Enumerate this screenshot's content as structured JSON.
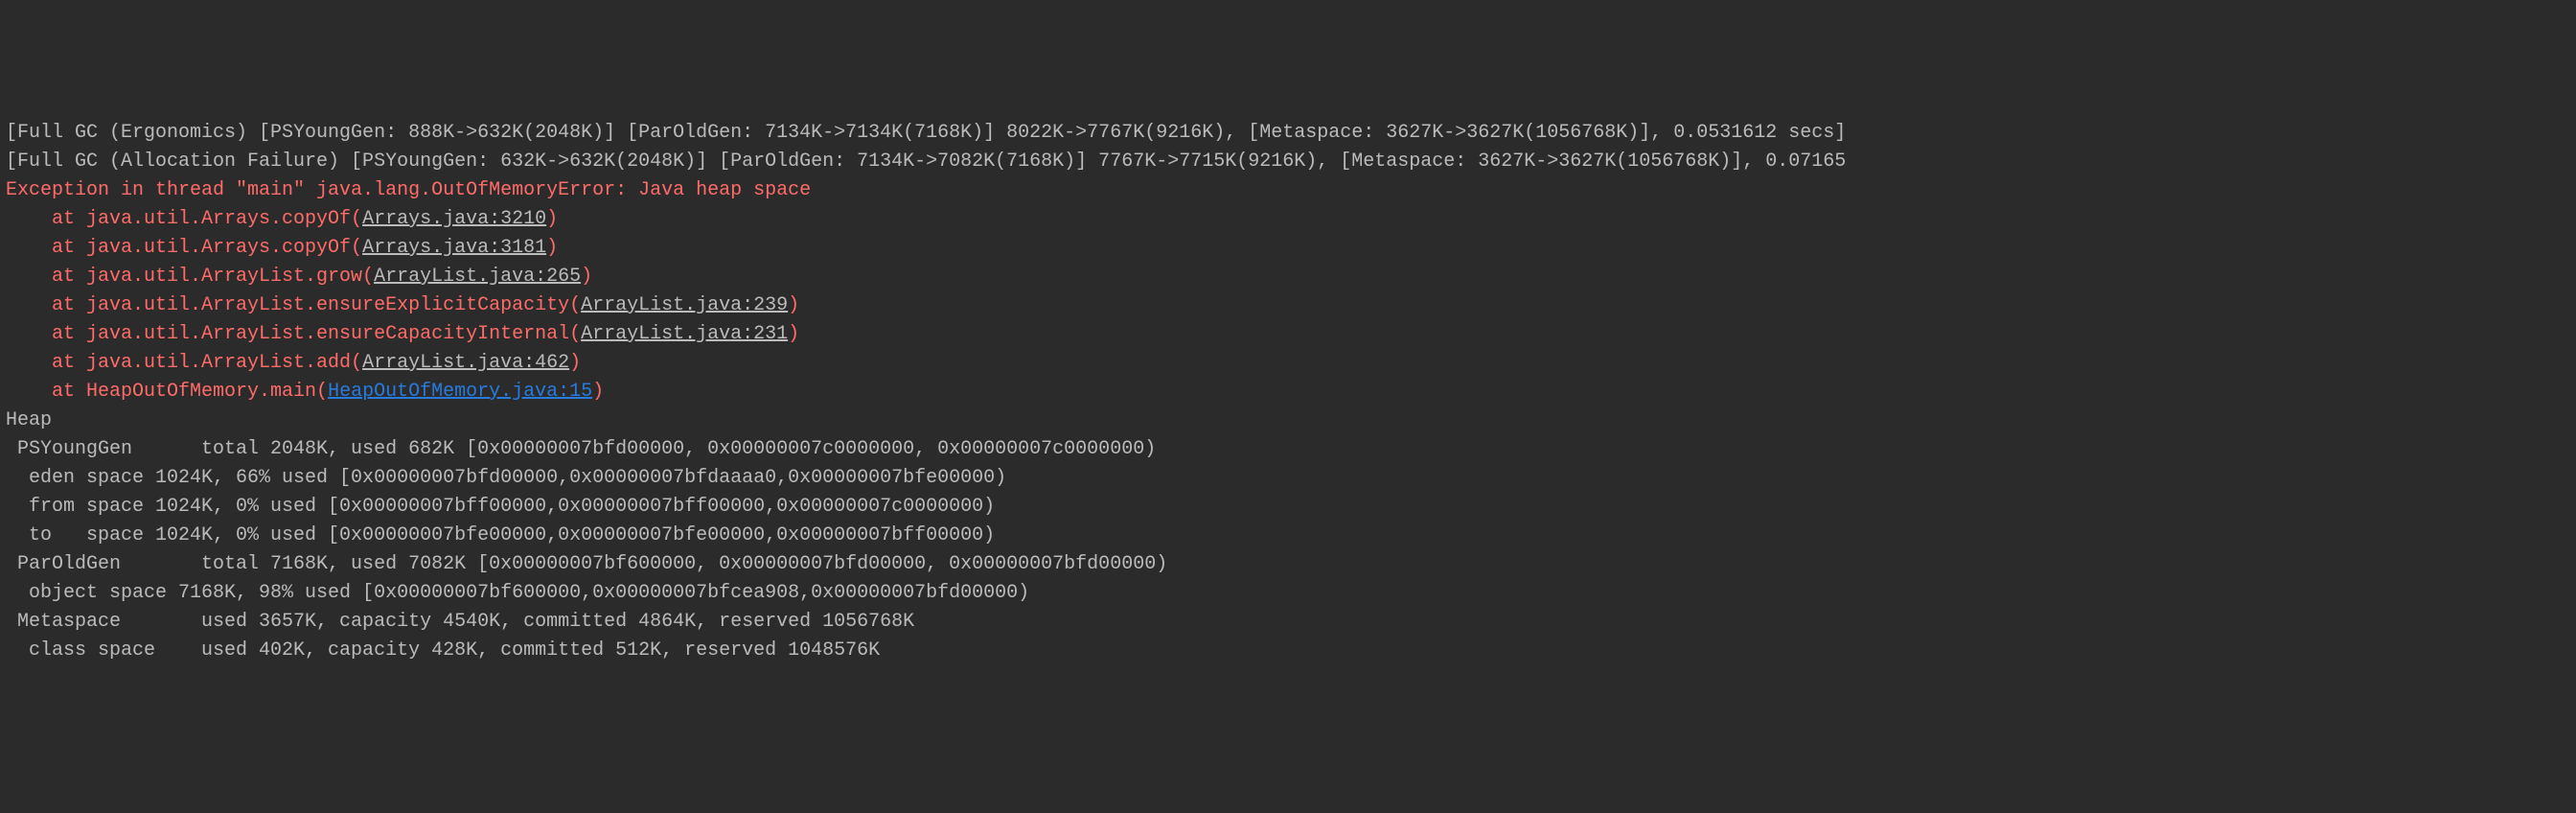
{
  "gc_lines": [
    "[Full GC (Ergonomics) [PSYoungGen: 888K->632K(2048K)] [ParOldGen: 7134K->7134K(7168K)] 8022K->7767K(9216K), [Metaspace: 3627K->3627K(1056768K)], 0.0531612 secs]",
    "[Full GC (Allocation Failure) [PSYoungGen: 632K->632K(2048K)] [ParOldGen: 7134K->7082K(7168K)] 7767K->7715K(9216K), [Metaspace: 3627K->3627K(1056768K)], 0.07165"
  ],
  "exception_header": "Exception in thread \"main\" java.lang.OutOfMemoryError: Java heap space",
  "stack": [
    {
      "prefix": "    at java.util.Arrays.copyOf(",
      "link": "Arrays.java:3210",
      "suffix": ")",
      "blue": false
    },
    {
      "prefix": "    at java.util.Arrays.copyOf(",
      "link": "Arrays.java:3181",
      "suffix": ")",
      "blue": false
    },
    {
      "prefix": "    at java.util.ArrayList.grow(",
      "link": "ArrayList.java:265",
      "suffix": ")",
      "blue": false
    },
    {
      "prefix": "    at java.util.ArrayList.ensureExplicitCapacity(",
      "link": "ArrayList.java:239",
      "suffix": ")",
      "blue": false
    },
    {
      "prefix": "    at java.util.ArrayList.ensureCapacityInternal(",
      "link": "ArrayList.java:231",
      "suffix": ")",
      "blue": false
    },
    {
      "prefix": "    at java.util.ArrayList.add(",
      "link": "ArrayList.java:462",
      "suffix": ")",
      "blue": false
    },
    {
      "prefix": "    at HeapOutOfMemory.main(",
      "link": "HeapOutOfMemory.java:15",
      "suffix": ")",
      "blue": true
    }
  ],
  "heap_lines": [
    "Heap",
    " PSYoungGen      total 2048K, used 682K [0x00000007bfd00000, 0x00000007c0000000, 0x00000007c0000000)",
    "  eden space 1024K, 66% used [0x00000007bfd00000,0x00000007bfdaaaa0,0x00000007bfe00000)",
    "  from space 1024K, 0% used [0x00000007bff00000,0x00000007bff00000,0x00000007c0000000)",
    "  to   space 1024K, 0% used [0x00000007bfe00000,0x00000007bfe00000,0x00000007bff00000)",
    " ParOldGen       total 7168K, used 7082K [0x00000007bf600000, 0x00000007bfd00000, 0x00000007bfd00000)",
    "  object space 7168K, 98% used [0x00000007bf600000,0x00000007bfcea908,0x00000007bfd00000)",
    " Metaspace       used 3657K, capacity 4540K, committed 4864K, reserved 1056768K",
    "  class space    used 402K, capacity 428K, committed 512K, reserved 1048576K"
  ]
}
